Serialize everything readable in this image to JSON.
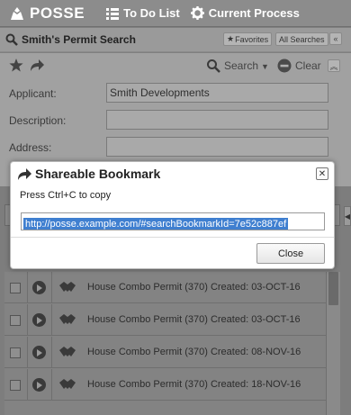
{
  "topnav": {
    "logo_text": "POSSE",
    "todo_label": "To Do List",
    "current_process_label": "Current Process"
  },
  "titlebar": {
    "title": "Smith's Permit Search",
    "favorites_label": "Favorites",
    "all_searches_label": "All Searches"
  },
  "toolbar": {
    "search_label": "Search",
    "clear_label": "Clear"
  },
  "form": {
    "applicant_label": "Applicant:",
    "applicant_value": "Smith Developments",
    "description_label": "Description:",
    "description_value": "",
    "address_label": "Address:",
    "address_value": ""
  },
  "results": [
    {
      "text": "House Combo Permit (370) Created: 03-OCT-16"
    },
    {
      "text": "House Combo Permit (370) Created: 03-OCT-16"
    },
    {
      "text": "House Combo Permit (370) Created: 08-NOV-16"
    },
    {
      "text": "House Combo Permit (370) Created: 18-NOV-16"
    }
  ],
  "dialog": {
    "title": "Shareable Bookmark",
    "hint": "Press Ctrl+C to copy",
    "url": "http://posse.example.com/#searchBookmarkId=7e52c887ef",
    "close_label": "Close"
  }
}
